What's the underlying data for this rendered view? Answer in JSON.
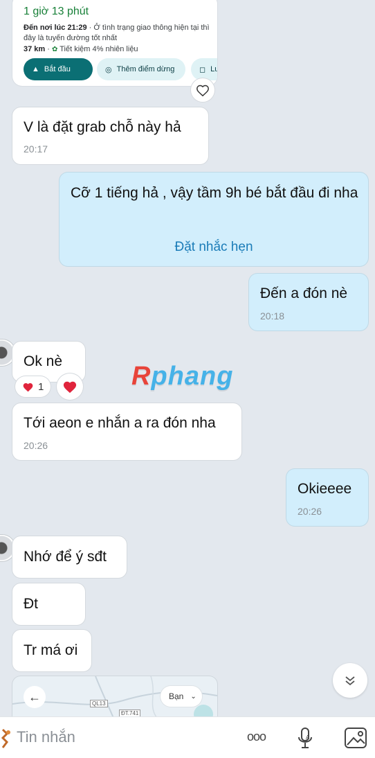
{
  "route_card": {
    "duration": "1 giờ 13 phút",
    "arrive_label": "Đến nơi lúc 21:29",
    "arrive_note": " · Ở tình trạng giao thông hiện tại thì đây là tuyến đường tốt nhất",
    "distance": "37 km",
    "fuel_note": "Tiết kiệm 4% nhiên liệu",
    "start_label": "Bắt đầu",
    "add_stop_label": "Thêm điểm dừng",
    "save_label": "Lưu"
  },
  "messages": [
    {
      "text": "V là đặt grab chỗ này hả",
      "time": "20:17"
    },
    {
      "text": "Cỡ 1 tiếng hả , vậy tầm 9h bé bắt đầu đi nha",
      "action": "Đặt nhắc hẹn"
    },
    {
      "text": "Đến a đón nè",
      "time": "20:18"
    },
    {
      "text": "Ok nè",
      "reaction_count": "1"
    },
    {
      "text": "Tới aeon e nhắn a ra đón nha",
      "time": "20:26"
    },
    {
      "text": "Okieeee",
      "time": "20:26"
    },
    {
      "text": "Nhớ để ý sđt"
    },
    {
      "text": "Đt"
    },
    {
      "text": "Tr má ơi"
    }
  ],
  "watermark": {
    "r": "R",
    "rest": "phang"
  },
  "map_preview": {
    "road_1": "QL13",
    "road_2": "ĐT.741",
    "label": "Bạn"
  },
  "composer": {
    "placeholder": "Tin nhắn",
    "more": "ooo"
  },
  "colors": {
    "outgoing": "#d2eefc",
    "incoming": "#ffffff",
    "accent": "#0b6f74",
    "heart": "#e0243c"
  }
}
